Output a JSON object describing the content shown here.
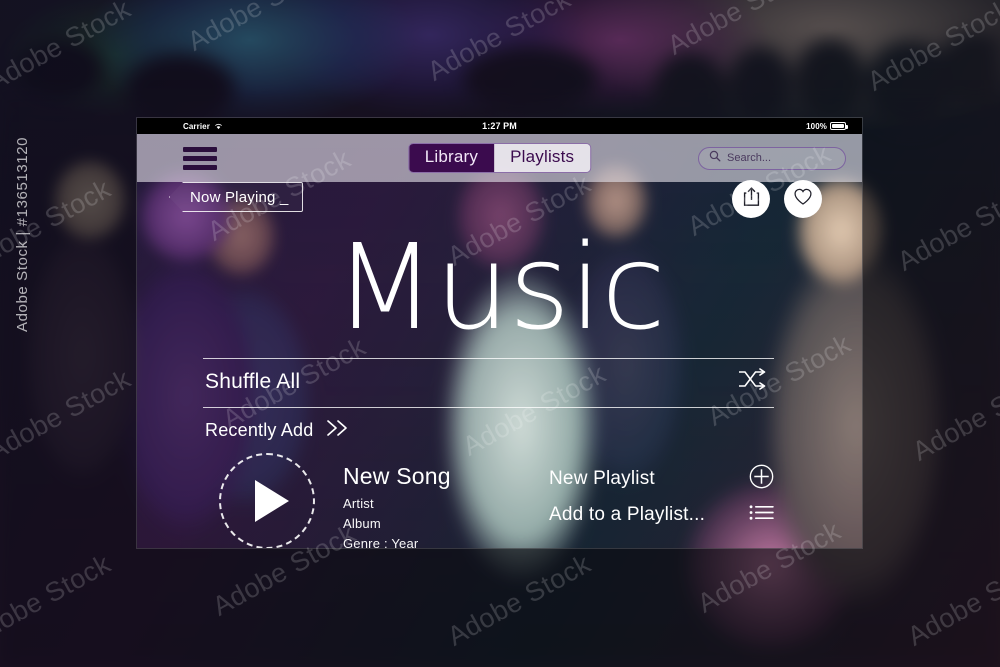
{
  "status_bar": {
    "carrier": "Carrier",
    "wifi_icon": "wifi-icon",
    "time": "1:27 PM",
    "battery_percent": "100%",
    "battery_icon": "battery-full-icon"
  },
  "nav": {
    "menu_icon": "hamburger-menu-icon",
    "tabs": [
      {
        "label": "Library",
        "active": true
      },
      {
        "label": "Playlists",
        "active": false
      }
    ],
    "search": {
      "icon": "search-icon",
      "placeholder": "Search..."
    }
  },
  "header": {
    "now_playing_label": "Now Playing _",
    "share_icon": "share-icon",
    "favorite_icon": "heart-icon"
  },
  "page_title": "Music",
  "shuffle": {
    "label": "Shuffle All",
    "icon": "shuffle-icon"
  },
  "recently_added": {
    "label": "Recently Add",
    "icon": "double-chevron-right-icon"
  },
  "now_playing_card": {
    "play_icon": "play-icon",
    "title": "New Song",
    "artist": "Artist",
    "album": "Album",
    "genre_year": "Genre : Year"
  },
  "playlist_actions": [
    {
      "label": "New Playlist",
      "icon": "plus-circle-icon"
    },
    {
      "label": "Add to a Playlist...",
      "icon": "list-icon"
    }
  ],
  "watermarks": {
    "brand": "Adobe Stock",
    "asset_line": "Adobe Stock | #136513120"
  },
  "colors": {
    "accent_purple": "#3b0b4e",
    "panel_chrome": "#e4e0e9",
    "text_on_photo": "#ffffff"
  }
}
